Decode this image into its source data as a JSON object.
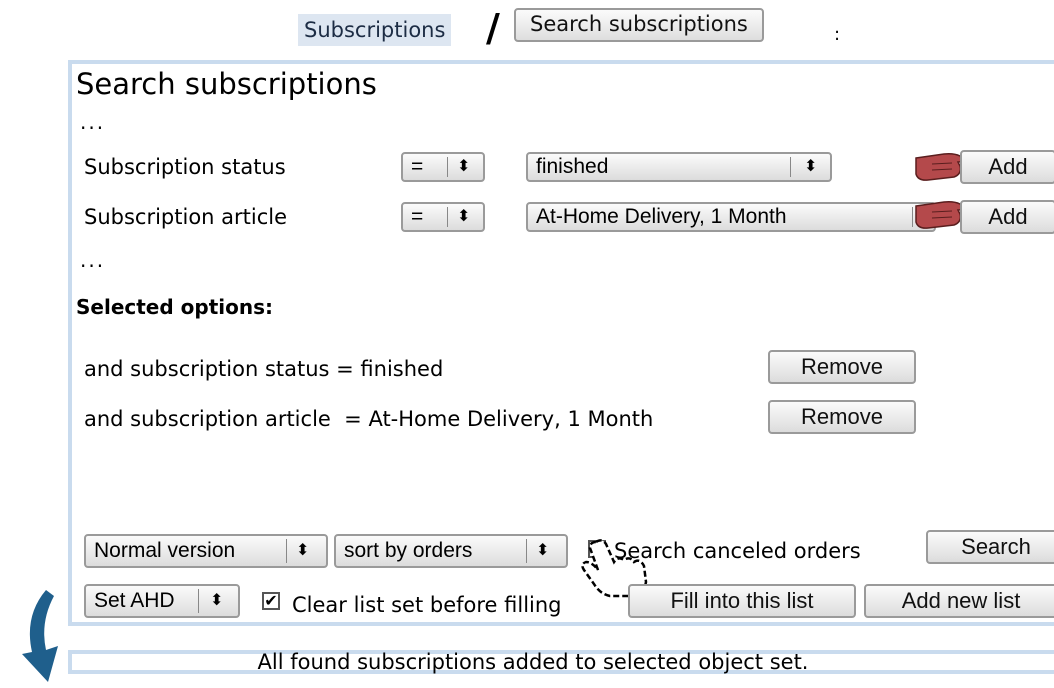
{
  "breadcrumb": {
    "tab_label": "Subscriptions",
    "separator": "/",
    "button_label": "Search subscriptions",
    "trailing": ":"
  },
  "panel": {
    "title": "Search subscriptions",
    "ellipsis_top": "...",
    "ellipsis_bottom": "...",
    "criteria": [
      {
        "label": "Subscription status",
        "operator": "=",
        "value": "finished",
        "add_label": "Add"
      },
      {
        "label": "Subscription article",
        "operator": "=",
        "value": "At-Home Delivery, 1 Month",
        "add_label": "Add"
      }
    ],
    "selected_heading": "Selected options:",
    "selected": [
      {
        "text": "and subscription status = finished",
        "remove_label": "Remove"
      },
      {
        "text": "and subscription article  = At-Home Delivery, 1 Month",
        "remove_label": "Remove"
      }
    ],
    "bottom_row1": {
      "version_select": "Normal version",
      "sort_select": "sort by orders",
      "canceled_checkbox_label": "Search canceled orders",
      "canceled_checked": false,
      "search_label": "Search"
    },
    "bottom_row2": {
      "set_select": "Set AHD",
      "clear_checkbox_label": "Clear list set before filling",
      "clear_checked": true,
      "fill_label": "Fill into this list",
      "add_new_label": "Add new list"
    }
  },
  "status_message": "All found subscriptions added to selected object set.",
  "colors": {
    "panel_border": "#c9dbee",
    "tab_bg": "#dde6f1",
    "arrow": "#1f5f8c",
    "hand": "#b4494b"
  },
  "icons": [
    "pointing-hand-icon",
    "hand-cursor-icon",
    "curved-arrow-icon",
    "checkmark-icon"
  ]
}
